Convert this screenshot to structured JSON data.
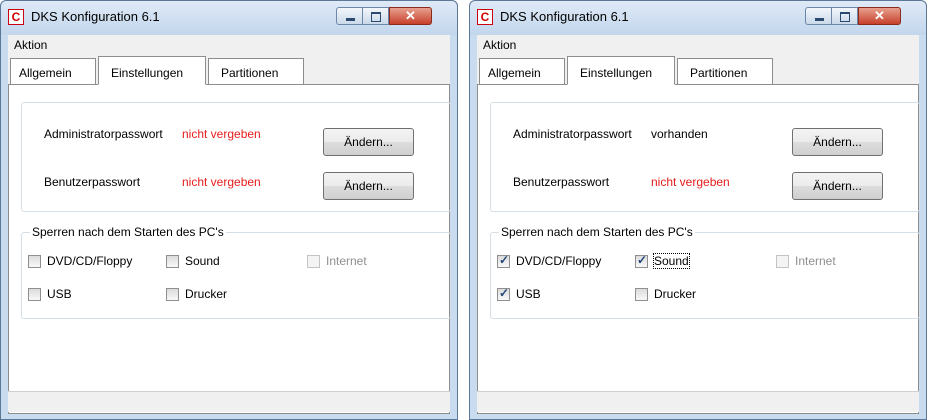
{
  "windows": [
    {
      "title": "DKS Konfiguration 6.1",
      "app_icon": "C",
      "menu": {
        "aktion": "Aktion"
      },
      "tabs": [
        "Allgemein",
        "Einstellungen",
        "Partitionen"
      ],
      "admin_label": "Administratorpasswort",
      "admin_status": "nicht vergeben",
      "user_label": "Benutzerpasswort",
      "user_status": "nicht vergeben",
      "change_button": "Ändern...",
      "group_title": "Sperren nach dem Starten des PC's",
      "checkboxes": [
        {
          "label": "DVD/CD/Floppy",
          "checked": false
        },
        {
          "label": "Sound",
          "checked": false
        },
        {
          "label": "Internet",
          "checked": false,
          "disabled": true
        },
        {
          "label": "USB",
          "checked": false
        },
        {
          "label": "Drucker",
          "checked": false
        }
      ]
    },
    {
      "title": "DKS Konfiguration 6.1",
      "app_icon": "C",
      "menu": {
        "aktion": "Aktion"
      },
      "tabs": [
        "Allgemein",
        "Einstellungen",
        "Partitionen"
      ],
      "admin_label": "Administratorpasswort",
      "admin_status": "vorhanden",
      "user_label": "Benutzerpasswort",
      "user_status": "nicht vergeben",
      "change_button": "Ändern...",
      "group_title": "Sperren nach dem Starten des PC's",
      "checkboxes": [
        {
          "label": "DVD/CD/Floppy",
          "checked": true
        },
        {
          "label": "Sound",
          "checked": true
        },
        {
          "label": "Internet",
          "checked": false,
          "disabled": true
        },
        {
          "label": "USB",
          "checked": true
        },
        {
          "label": "Drucker",
          "checked": false
        }
      ]
    }
  ],
  "icons": {
    "close": "close-icon",
    "minimize": "minimize-icon",
    "maximize": "maximize-icon",
    "check": "check-icon"
  },
  "colors": {
    "status_red": "#e61c1c",
    "titlebar": "#c9dcef",
    "close_button": "#c7402b"
  }
}
